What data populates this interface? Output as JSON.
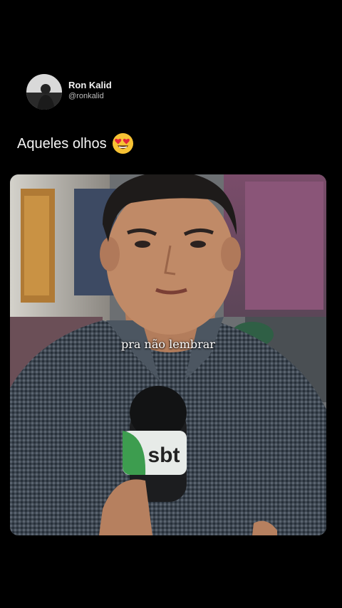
{
  "tweet": {
    "author_name": "Ron Kalid",
    "author_handle": "@ronkalid",
    "text": "Aqueles olhos",
    "emoji_icon": "heart-eyes-emoji-icon"
  },
  "video": {
    "caption": "pra não lembrar",
    "mic_logo_text": "sbt"
  },
  "colors": {
    "background": "#000000",
    "emoji_face": "#f7c234",
    "emoji_hearts": "#e3263b"
  }
}
